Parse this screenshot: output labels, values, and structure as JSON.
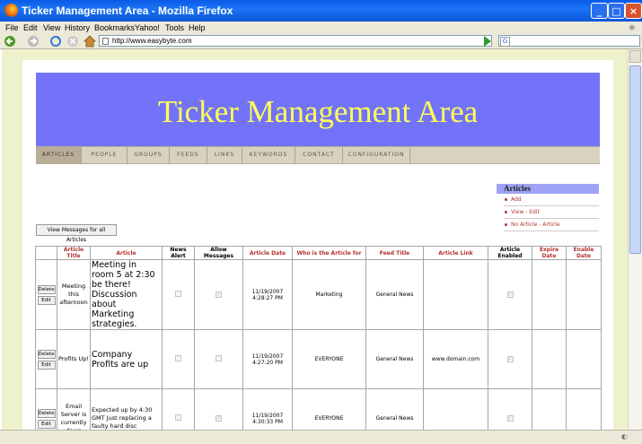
{
  "window": {
    "title": "Ticker Management Area - Mozilla Firefox"
  },
  "menu": [
    "File",
    "Edit",
    "View",
    "History",
    "Bookmarks",
    "Yahoo!",
    "Tools",
    "Help"
  ],
  "address": {
    "url": "http://www.easybyte.com"
  },
  "page": {
    "banner_title": "Ticker Management Area",
    "nav_tabs": [
      "ARTICLES",
      "PEOPLE",
      "GROUPS",
      "FEEDS",
      "LINKS",
      "KEYWORDS",
      "CONTACT",
      "CONFIGURATION"
    ],
    "active_tab": "ARTICLES",
    "sidebar": {
      "title": "Articles",
      "links": [
        "Add",
        "View - Edit",
        "No Article - Article"
      ]
    },
    "view_messages_button": "View Messages for all Articles",
    "table": {
      "columns": [
        "",
        "Article Title",
        "Article",
        "News Alert",
        "Allow Messages",
        "Article Date",
        "Who is the Article for",
        "Feed Title",
        "Article Link",
        "Article Enabled",
        "Expire Date",
        "Enable Date"
      ],
      "delete_label": "Delete",
      "edit_label": "Edit",
      "rows": [
        {
          "title": "Meeting this afternoon",
          "article": "Meeting in room 5 at 2:30 be there! Discussion about Marketing strategies.",
          "news_alert": false,
          "allow_messages": true,
          "date": "11/19/2007",
          "time": "4:28:27 PM",
          "who": "Marketing",
          "feed": "General News",
          "link": "",
          "enabled": true,
          "expire": "",
          "enable": ""
        },
        {
          "title": "Profits Up!",
          "article": "Company Profits are up",
          "news_alert": false,
          "allow_messages": false,
          "date": "11/19/2007",
          "time": "4:27:20 PM",
          "who": "EVERYONE",
          "feed": "General News",
          "link": "www.domain.com",
          "enabled": true,
          "expire": "",
          "enable": ""
        },
        {
          "title": "Email Server is currently down",
          "article": "Expected up by 4:30 GMT Just replacing a faulty hard disc",
          "news_alert": false,
          "allow_messages": true,
          "date": "11/19/2007",
          "time": "4:30:33 PM",
          "who": "EVERYONE",
          "feed": "General News",
          "link": "",
          "enabled": true,
          "expire": "",
          "enable": ""
        }
      ]
    }
  }
}
